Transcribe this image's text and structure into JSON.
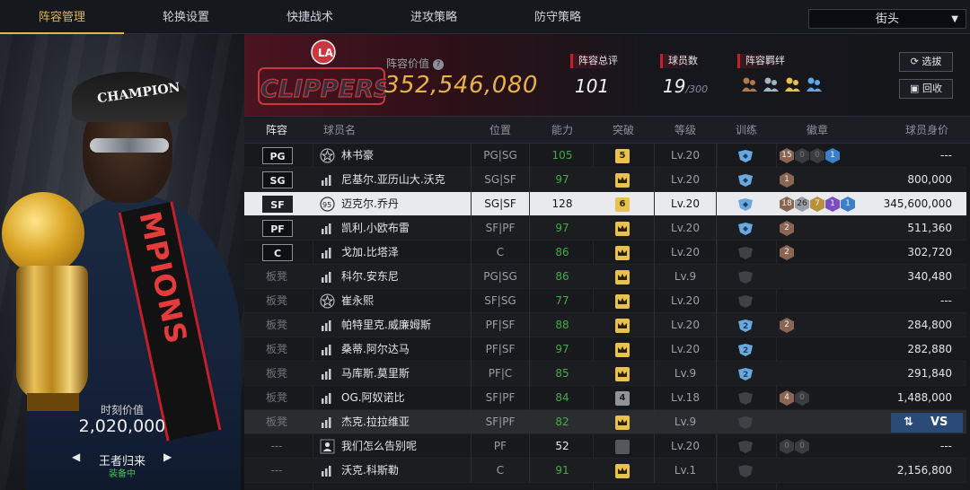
{
  "tabs": [
    {
      "label": "阵容管理",
      "active": true
    },
    {
      "label": "轮换设置",
      "active": false
    },
    {
      "label": "快捷战术",
      "active": false
    },
    {
      "label": "进攻策略",
      "active": false
    },
    {
      "label": "防守策略",
      "active": false
    }
  ],
  "mode_select": {
    "value": "街头"
  },
  "card": {
    "value_label": "时刻价值",
    "value": "2,020,000",
    "skin_name": "王者归来",
    "equipped": "装备中",
    "prev_icon": "◀",
    "next_icon": "▶",
    "image_texts": [
      "CHAMPION",
      "MPIONS"
    ]
  },
  "header": {
    "logo_text": "CLIPPERS",
    "team_value_label": "阵容价值",
    "help_icon": "?",
    "team_value": "352,546,080",
    "stats": [
      {
        "label": "阵容总评",
        "value": "101",
        "sub": ""
      },
      {
        "label": "球员数",
        "value": "19",
        "sub": "/300"
      },
      {
        "label": "阵容羁绊",
        "value": "",
        "sub": ""
      }
    ],
    "buttons": [
      {
        "label": "选拔",
        "icon": "refresh-icon"
      },
      {
        "label": "回收",
        "icon": "recycle-icon"
      }
    ]
  },
  "table": {
    "headers": [
      "阵容",
      "球员名",
      "位置",
      "能力",
      "突破",
      "等级",
      "训练",
      "徽章",
      "球员身价"
    ],
    "swap_label": "VS",
    "rows": [
      {
        "slot": "PG",
        "starter": true,
        "icon": "star",
        "name": "林书豪",
        "pos": "PG|SG",
        "ability": "105",
        "bt": "5",
        "level": "Lv.20",
        "train": "blue",
        "badges": [
          [
            "bronze",
            "15"
          ],
          [
            "empty",
            "0"
          ],
          [
            "empty",
            "0"
          ],
          [
            "blue",
            "1"
          ]
        ],
        "salary": "---"
      },
      {
        "slot": "SG",
        "starter": true,
        "icon": "bar",
        "name": "尼基尔.亚历山大.沃克",
        "pos": "SG|SF",
        "ability": "97",
        "bt": "crown",
        "level": "Lv.20",
        "train": "blue",
        "badges": [
          [
            "bronze",
            "1"
          ]
        ],
        "salary": "800,000"
      },
      {
        "slot": "SF",
        "starter": true,
        "icon": "circle",
        "icon_text": "95",
        "name": "迈克尔.乔丹",
        "pos": "SG|SF",
        "ability": "128",
        "bt": "6",
        "level": "Lv.20",
        "train": "blue",
        "badges": [
          [
            "bronze",
            "18"
          ],
          [
            "silver",
            "26"
          ],
          [
            "gold",
            "7"
          ],
          [
            "purple",
            "1"
          ],
          [
            "blue",
            "1"
          ]
        ],
        "salary": "345,600,000",
        "selected": true
      },
      {
        "slot": "PF",
        "starter": true,
        "icon": "bar",
        "name": "凯利.小欧布雷",
        "pos": "SF|PF",
        "ability": "97",
        "bt": "crown",
        "level": "Lv.20",
        "train": "blue",
        "badges": [
          [
            "bronze",
            "2"
          ]
        ],
        "salary": "511,360"
      },
      {
        "slot": "C",
        "starter": true,
        "icon": "bar",
        "name": "戈加.比塔泽",
        "pos": "C",
        "ability": "86",
        "bt": "crown",
        "level": "Lv.20",
        "train": "grey",
        "badges": [
          [
            "bronze",
            "2"
          ]
        ],
        "salary": "302,720"
      },
      {
        "slot": "板凳",
        "starter": false,
        "icon": "bar",
        "name": "科尔.安东尼",
        "pos": "PG|SG",
        "ability": "86",
        "bt": "crown",
        "level": "Lv.9",
        "train": "grey",
        "badges": [],
        "salary": "340,480"
      },
      {
        "slot": "板凳",
        "starter": false,
        "icon": "star",
        "name": "崔永熙",
        "pos": "SF|SG",
        "ability": "77",
        "bt": "crown",
        "level": "Lv.20",
        "train": "grey",
        "badges": [],
        "salary": "---"
      },
      {
        "slot": "板凳",
        "starter": false,
        "icon": "bar",
        "name": "帕特里克.威廉姆斯",
        "pos": "PF|SF",
        "ability": "88",
        "bt": "crown",
        "level": "Lv.20",
        "train": "blue2",
        "badges": [
          [
            "bronze",
            "2"
          ]
        ],
        "salary": "284,800"
      },
      {
        "slot": "板凳",
        "starter": false,
        "icon": "bar",
        "name": "桑蒂.阿尔达马",
        "pos": "PF|SF",
        "ability": "97",
        "bt": "crown",
        "level": "Lv.20",
        "train": "blue2",
        "badges": [],
        "salary": "282,880"
      },
      {
        "slot": "板凳",
        "starter": false,
        "icon": "bar",
        "name": "马库斯.莫里斯",
        "pos": "PF|C",
        "ability": "85",
        "bt": "crown",
        "level": "Lv.9",
        "train": "blue2",
        "badges": [],
        "salary": "291,840"
      },
      {
        "slot": "板凳",
        "starter": false,
        "icon": "bar",
        "name": "OG.阿奴诺比",
        "pos": "SF|PF",
        "ability": "84",
        "bt": "4",
        "level": "Lv.18",
        "train": "grey",
        "badges": [
          [
            "bronze",
            "4"
          ],
          [
            "empty",
            "0"
          ]
        ],
        "salary": "1,488,000"
      },
      {
        "slot": "板凳",
        "starter": false,
        "icon": "bar",
        "name": "杰克.拉拉维亚",
        "pos": "SF|PF",
        "ability": "82",
        "bt": "crown",
        "level": "Lv.9",
        "train": "grey",
        "badges": [],
        "salary": "",
        "dark": true,
        "swap": true
      },
      {
        "slot": "---",
        "starter": false,
        "icon": "person",
        "name": "我们怎么告别呢",
        "pos": "PF",
        "ability": "52",
        "bt": "dim",
        "level": "Lv.20",
        "train": "grey",
        "badges": [
          [
            "empty",
            "0"
          ],
          [
            "empty",
            "0"
          ]
        ],
        "salary": "---",
        "ability_white": true
      },
      {
        "slot": "---",
        "starter": false,
        "icon": "bar",
        "name": "沃克.科斯勒",
        "pos": "C",
        "ability": "91",
        "bt": "crown",
        "level": "Lv.1",
        "train": "grey",
        "badges": [],
        "salary": "2,156,800"
      }
    ]
  },
  "colors": {
    "accent": "#e6b54a",
    "team_red": "#c32030",
    "ability_green": "#47a947",
    "selected_row": "#e8eaed"
  }
}
